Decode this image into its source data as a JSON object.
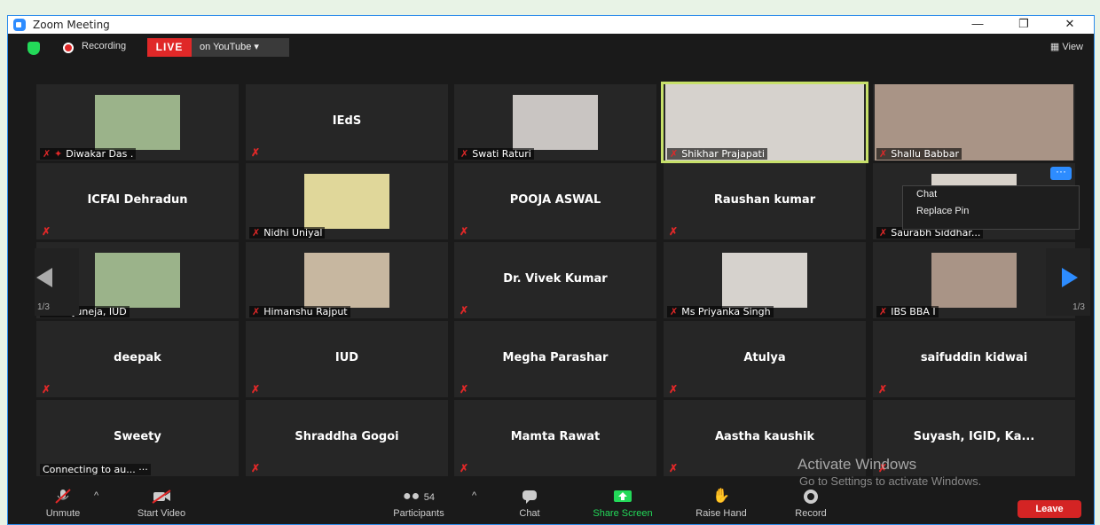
{
  "window": {
    "title": "Zoom Meeting",
    "minimize": "—",
    "restore": "❐",
    "close": "✕"
  },
  "topbar": {
    "recording": "Recording",
    "live": "LIVE",
    "stream": "on YouTube ▾",
    "view": "▦ View"
  },
  "tiles": [
    {
      "name": "Diwakar Das .",
      "video": true,
      "pinned": true
    },
    {
      "name": "IEdS"
    },
    {
      "name": "Swati Raturi",
      "video": true
    },
    {
      "name": "Shikhar Prajapati",
      "video": true,
      "active": true
    },
    {
      "name": "Shallu Babbar",
      "video": true
    },
    {
      "name": "ICFAI Dehradun"
    },
    {
      "name": "Nidhi Uniyal",
      "video": true
    },
    {
      "name": "POOJA ASWAL"
    },
    {
      "name": "Raushan kumar"
    },
    {
      "name": "Saurabh Siddhar...",
      "video": true
    },
    {
      "name": "Ria Juneja, IUD",
      "video": true
    },
    {
      "name": "Himanshu Rajput",
      "video": true
    },
    {
      "name": "Dr. Vivek Kumar"
    },
    {
      "name": "Ms Priyanka Singh",
      "video": true
    },
    {
      "name": "IBS BBA I",
      "video": true
    },
    {
      "name": "deepak"
    },
    {
      "name": "IUD"
    },
    {
      "name": "Megha Parashar"
    },
    {
      "name": "Atulya"
    },
    {
      "name": "saifuddin kidwai"
    },
    {
      "name": "Sweety",
      "status": "Connecting to au... ···"
    },
    {
      "name": "Shraddha Gogoi"
    },
    {
      "name": "Mamta Rawat"
    },
    {
      "name": "Aastha kaushik"
    },
    {
      "name": "Suyash, IGID, Ka..."
    }
  ],
  "pagination": {
    "left": "1/3",
    "right": "1/3"
  },
  "context_menu": {
    "more": "···",
    "items": [
      "Chat",
      "Replace Pin"
    ]
  },
  "footer": {
    "unmute": "Unmute",
    "start_video": "Start Video",
    "participants": "Participants",
    "participants_count": "54",
    "chat": "Chat",
    "share_screen": "Share Screen",
    "raise_hand": "Raise Hand",
    "record": "Record",
    "leave": "Leave"
  },
  "watermark": {
    "line1": "Activate Windows",
    "line2": "Go to Settings to activate Windows."
  },
  "colors": {
    "accent": "#2d8cff",
    "live": "#e02828",
    "share": "#23d959",
    "active_border": "#c7e06a"
  }
}
